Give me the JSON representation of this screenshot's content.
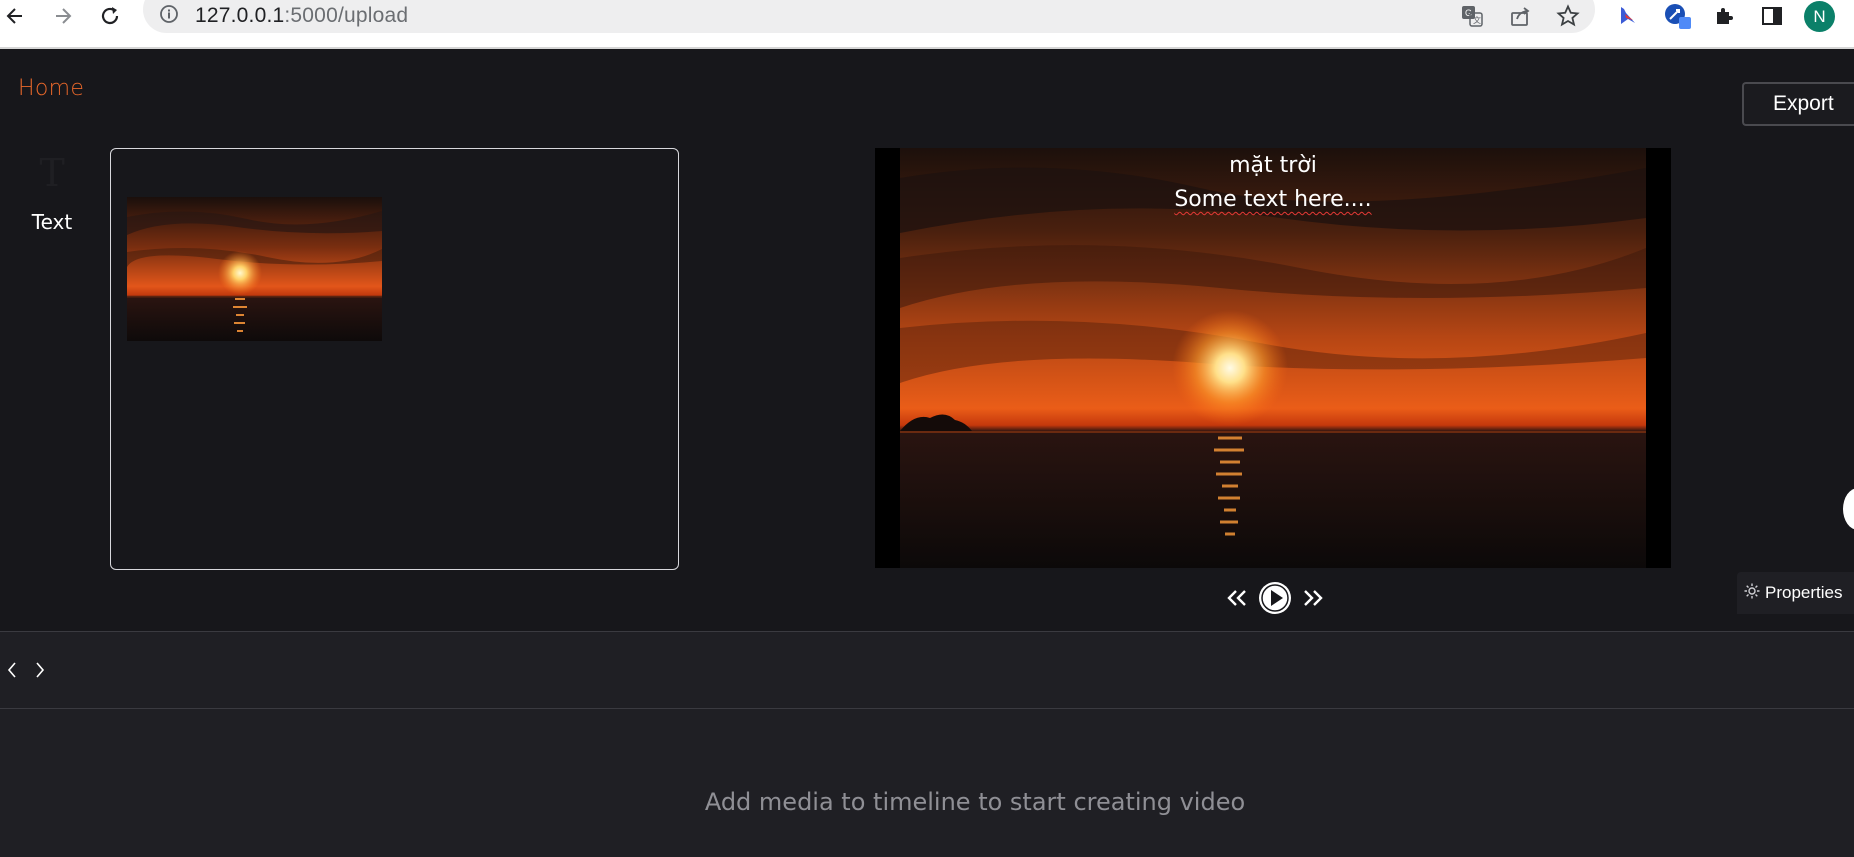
{
  "browser": {
    "url_host": "127.0.0.1",
    "url_path": ":5000/upload",
    "profile_initial": "N",
    "icons": [
      "back-icon",
      "forward-icon",
      "reload-icon",
      "info-icon",
      "translate-icon",
      "share-icon",
      "bookmark-star-icon",
      "extension-bing-icon",
      "extension-avatar-icon",
      "puzzle-extensions-icon",
      "side-panel-icon"
    ]
  },
  "app": {
    "home_label": "Home",
    "export_label": "Export",
    "tool_text_glyph": "T",
    "tool_text_label": "Text",
    "media_thumbnail_icon": "sunset-image",
    "preview": {
      "line1": "mặt trời",
      "line2": "Some text here...."
    },
    "properties_label": "Properties",
    "empty_timeline_message": "Add media to timeline to start creating video",
    "accent_color": "#e8672a"
  }
}
